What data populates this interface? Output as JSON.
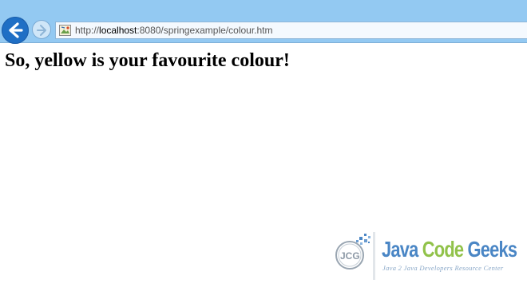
{
  "browser": {
    "back_icon": "arrow-left-icon",
    "forward_icon": "arrow-right-icon",
    "favicon": "broken-image-icon",
    "address": {
      "scheme": "http://",
      "host": "localhost",
      "path": ":8080/springexample/colour.htm"
    }
  },
  "page": {
    "heading": "So, yellow is your favourite colour!"
  },
  "watermark": {
    "word1": "Java",
    "word2": "Code",
    "word3": "Geeks",
    "tagline": "Java 2 Java Developers Resource Center"
  },
  "colors": {
    "toolbar": "#93c9f2",
    "back_button": "#1f6fc5",
    "brand_blue": "#4a86c5",
    "brand_green": "#91c24a"
  }
}
